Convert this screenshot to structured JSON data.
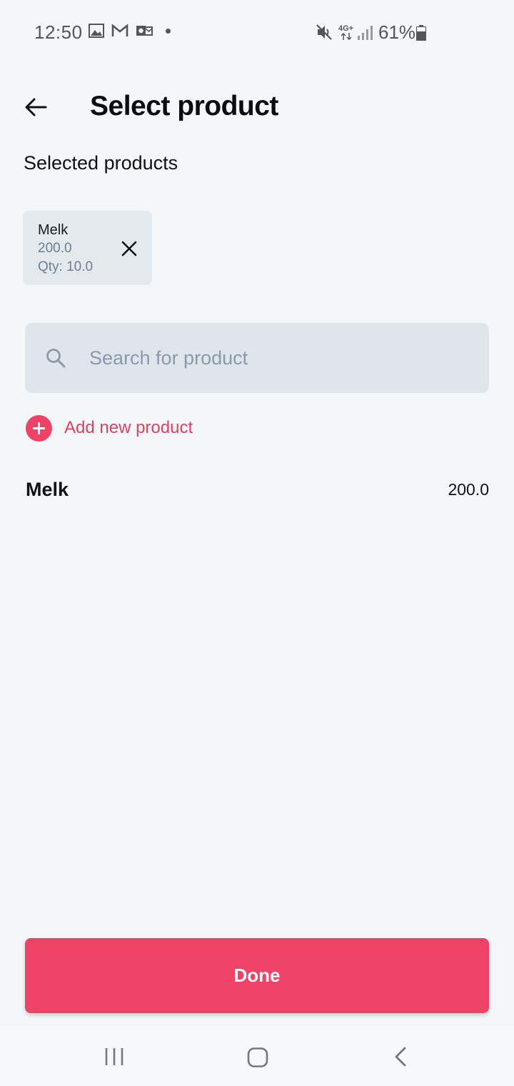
{
  "status_bar": {
    "time": "12:50",
    "battery": "61%",
    "network": "4G+",
    "left_icons": [
      "image-icon",
      "gmail-icon",
      "outlook-icon"
    ],
    "right_icons": [
      "mute-icon",
      "signal-icon",
      "battery-icon"
    ]
  },
  "header": {
    "title": "Select product",
    "back_icon": "arrow-left-icon"
  },
  "selected_section": {
    "title": "Selected products",
    "items": [
      {
        "name": "Melk",
        "price": "200.0",
        "qty": "Qty: 10.0"
      }
    ]
  },
  "search": {
    "placeholder": "Search for product",
    "value": ""
  },
  "add_new": {
    "label": "Add new product"
  },
  "products": [
    {
      "name": "Melk",
      "price": "200.0"
    }
  ],
  "footer": {
    "done_label": "Done"
  },
  "colors": {
    "accent": "#ee4266",
    "background": "#f4f7fa",
    "chip": "#e4e9ee",
    "search_bg": "#dfe5eb"
  }
}
